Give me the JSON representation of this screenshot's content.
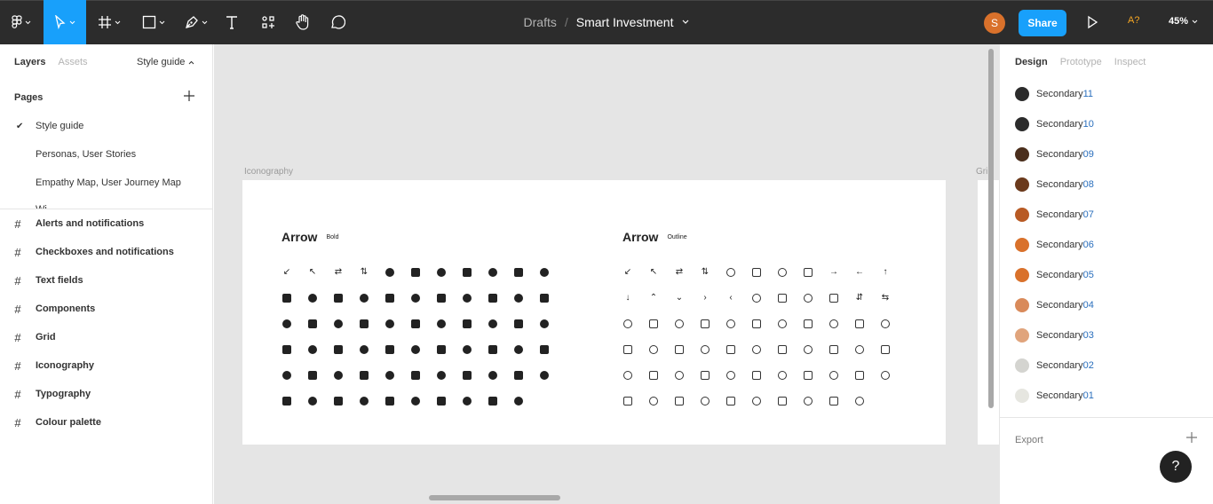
{
  "toolbar": {
    "breadcrumb_root": "Drafts",
    "breadcrumb_sep": "/",
    "file_name": "Smart Investment",
    "avatar_initial": "S",
    "share_label": "Share",
    "accessibility_label": "A?",
    "zoom": "45%"
  },
  "left_panel": {
    "tabs": [
      "Layers",
      "Assets"
    ],
    "page_selector": "Style guide",
    "pages_header": "Pages",
    "pages": [
      "Style guide",
      "Personas, User Stories",
      "Empathy Map, User Journey Map",
      "Wi..."
    ],
    "layers": [
      "Alerts and notifications",
      "Checkboxes and notifications",
      "Text fields",
      "Components",
      "Grid",
      "Iconography",
      "Typography",
      "Colour palette"
    ]
  },
  "canvas": {
    "frame_label": "Iconography",
    "frame2_label": "Gri",
    "section_bold_title": "Arrow",
    "section_bold_tag": "Bold",
    "section_outline_title": "Arrow",
    "section_outline_tag": "Outline"
  },
  "right_panel": {
    "tabs": [
      "Design",
      "Prototype",
      "Inspect"
    ],
    "swatches": [
      {
        "prefix": "Secondary",
        "num": "11",
        "color": "#2b2b2b"
      },
      {
        "prefix": "Secondary",
        "num": "10",
        "color": "#2b2b2b"
      },
      {
        "prefix": "Secondary",
        "num": "09",
        "color": "#4a2e1c"
      },
      {
        "prefix": "Secondary",
        "num": "08",
        "color": "#6b3a1c"
      },
      {
        "prefix": "Secondary",
        "num": "07",
        "color": "#b85a24"
      },
      {
        "prefix": "Secondary",
        "num": "06",
        "color": "#d9712b"
      },
      {
        "prefix": "Secondary",
        "num": "05",
        "color": "#d9712b"
      },
      {
        "prefix": "Secondary",
        "num": "04",
        "color": "#d98a5a"
      },
      {
        "prefix": "Secondary",
        "num": "03",
        "color": "#e0a47c"
      },
      {
        "prefix": "Secondary",
        "num": "02",
        "color": "#d4d4d0"
      },
      {
        "prefix": "Secondary",
        "num": "01",
        "color": "#e6e6e0"
      }
    ],
    "export_label": "Export"
  },
  "help_label": "?"
}
